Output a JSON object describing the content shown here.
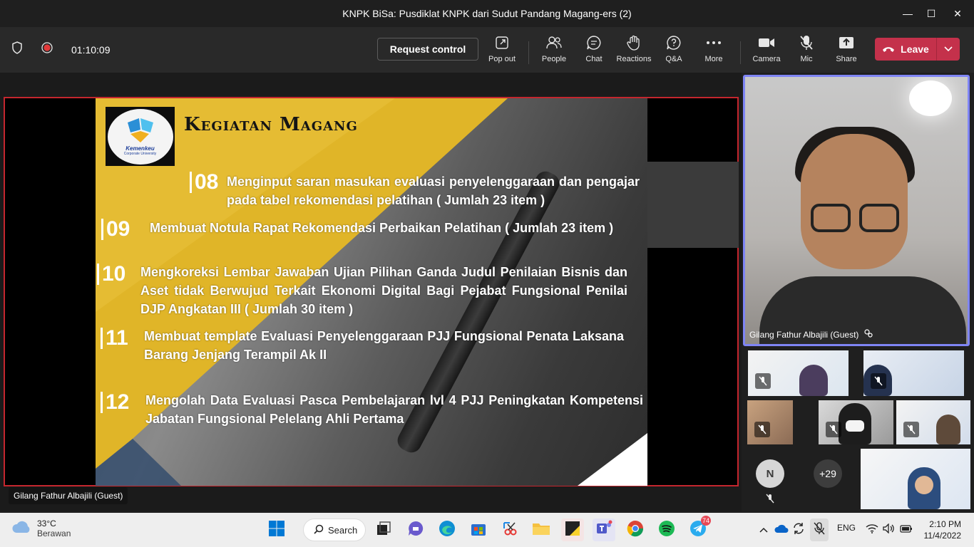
{
  "window": {
    "title": "KNPK BiSa: Pusdiklat KNPK dari Sudut Pandang Magang-ers (2)",
    "minimize_glyph": "—",
    "maximize_glyph": "☐",
    "close_glyph": "✕"
  },
  "toolbar": {
    "timer": "01:10:09",
    "request_control": "Request control",
    "pop_out": "Pop out",
    "people": "People",
    "chat": "Chat",
    "reactions": "Reactions",
    "qa": "Q&A",
    "more": "More",
    "camera": "Camera",
    "mic": "Mic",
    "share": "Share",
    "leave": "Leave"
  },
  "slide": {
    "title": "Kegiatan Magang",
    "logo_text": "Kemenkeu",
    "logo_subtext": "Corporate University",
    "items": [
      {
        "num": "08",
        "text": "Menginput saran masukan evaluasi penyelenggaraan dan pengajar pada tabel rekomendasi pelatihan ( Jumlah  23 item )"
      },
      {
        "num": "09",
        "text": "Membuat Notula Rapat Rekomendasi Perbaikan Pelatihan ( Jumlah  23 item )"
      },
      {
        "num": "10",
        "text": "Mengkoreksi Lembar Jawaban Ujian Pilihan Ganda Judul Penilaian Bisnis dan Aset tidak Berwujud Terkait Ekonomi Digital Bagi Pejabat  Fungsional Penilai DJP Angkatan III ( Jumlah 30 item )"
      },
      {
        "num": "11",
        "text": "Membuat template Evaluasi Penyelenggaraan PJJ Fungsional Penata Laksana Barang Jenjang Terampil Ak II"
      },
      {
        "num": "12",
        "text": "Mengolah Data Evaluasi Pasca Pembelajaran lvl 4 PJJ Peningkatan Kompetensi Jabatan Fungsional Pelelang Ahli Pertama"
      }
    ]
  },
  "presenter_label": "Gilang Fathur Albajili (Guest)",
  "main_video": {
    "name": "Gilang Fathur Albajili (Guest)"
  },
  "participants": {
    "avatar_initial": "N",
    "overflow": "+29"
  },
  "taskbar": {
    "temp": "33°C",
    "condition": "Berawan",
    "search": "Search",
    "telegram_badge": "74",
    "lang": "ENG",
    "time": "2:10 PM",
    "date": "11/4/2022"
  },
  "colors": {
    "accent": "#7f85f5",
    "leave": "#c4314b",
    "share_border": "#c4262e",
    "slide_yellow": "#e0b528"
  }
}
